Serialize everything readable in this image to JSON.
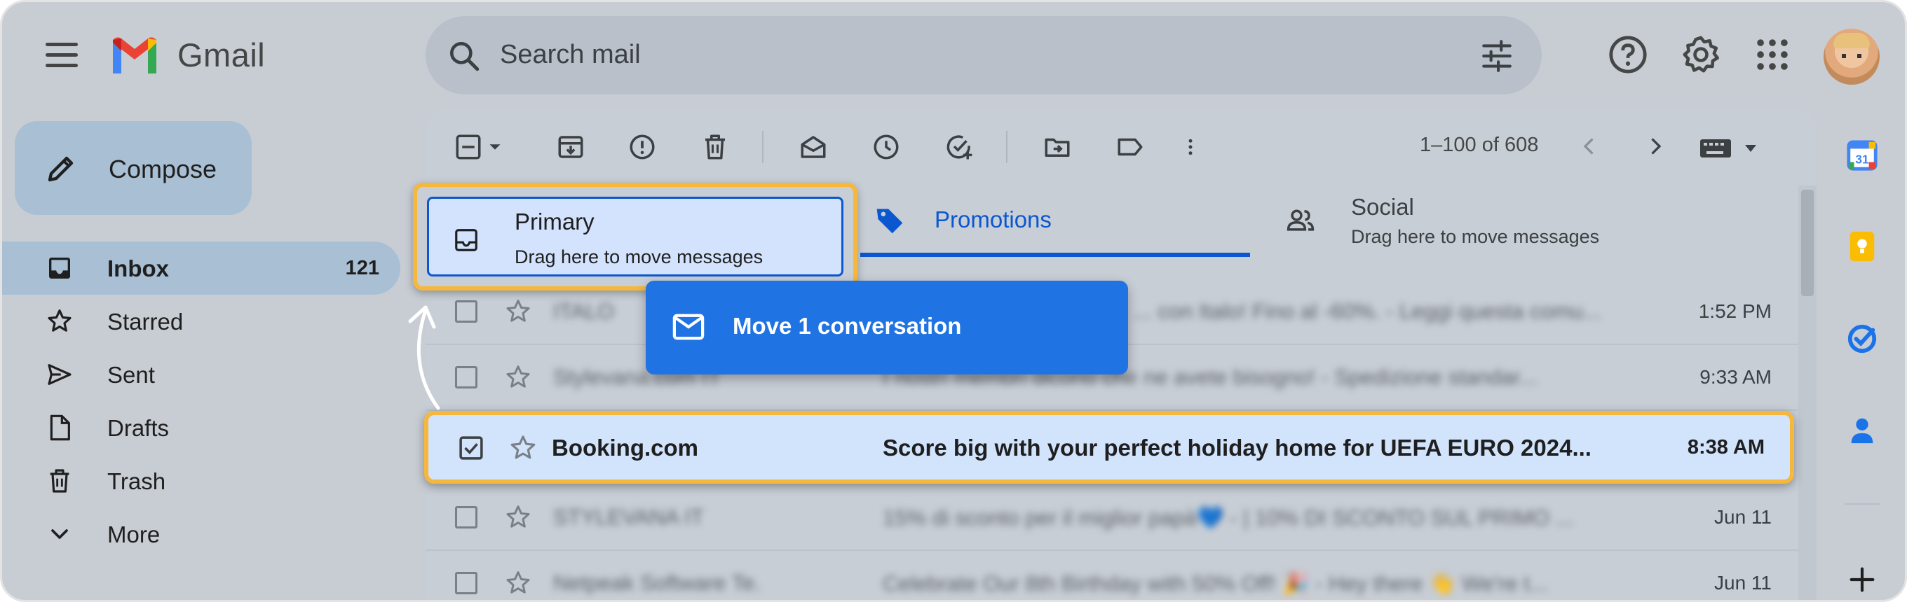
{
  "header": {
    "app_name": "Gmail",
    "search_placeholder": "Search mail"
  },
  "compose": {
    "label": "Compose"
  },
  "nav": {
    "items": [
      {
        "label": "Inbox",
        "count": "121",
        "icon": "inbox-icon",
        "active": true
      },
      {
        "label": "Starred",
        "icon": "star-icon"
      },
      {
        "label": "Sent",
        "icon": "send-icon"
      },
      {
        "label": "Drafts",
        "icon": "draft-icon"
      },
      {
        "label": "Trash",
        "icon": "trash-icon"
      },
      {
        "label": "More",
        "icon": "chevron-down-icon"
      }
    ]
  },
  "toolbar": {
    "pagination": "1–100 of 608"
  },
  "tabs": {
    "primary": {
      "label": "Primary",
      "subtitle": "Drag here to move messages"
    },
    "promotions": {
      "label": "Promotions"
    },
    "social": {
      "label": "Social",
      "subtitle": "Drag here to move messages"
    }
  },
  "drag": {
    "label": "Move 1 conversation"
  },
  "emails": [
    {
      "sender": "ITALO",
      "subject": "... con Italo! Fino al -60%. - Leggi questa comu...",
      "time": "1:52 PM"
    },
    {
      "sender": "Stylevana.com IT",
      "subject": "I nostri membri dicono che ne avete bisogno! - Spedizione standar...",
      "time": "9:33 AM"
    },
    {
      "sender": "Booking.com",
      "subject": "Score big with your perfect holiday home for UEFA EURO 2024...",
      "time": "8:38 AM",
      "selected": true
    },
    {
      "sender": "STYLEVANA IT",
      "subject": "15% di sconto per il miglior papà💙 - | 10% DI SCONTO SUL PRIMO ...",
      "time": "Jun 11"
    },
    {
      "sender": "Netpeak Software Te.",
      "subject": "Celebrate Our 8th Birthday with 50% Off! 🎉 - Hey there 👋 We're t...",
      "time": "Jun 11"
    }
  ],
  "colors": {
    "accent_blue": "#0b57d0",
    "highlight": "#f6b83c",
    "drag_card": "#1f73e2"
  }
}
